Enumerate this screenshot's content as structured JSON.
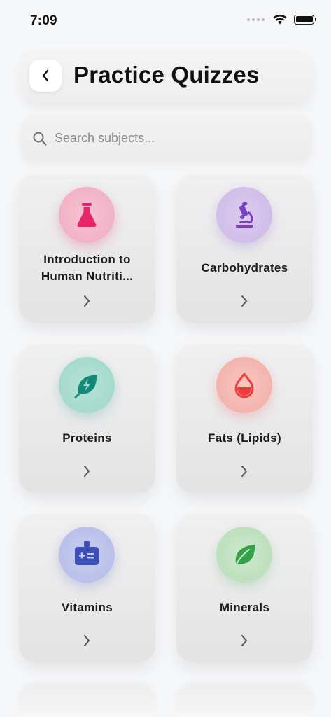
{
  "status_bar": {
    "time": "7:09"
  },
  "header": {
    "title": "Practice Quizzes",
    "back_icon": "chevron-left-icon"
  },
  "search": {
    "placeholder": "Search subjects...",
    "value": ""
  },
  "subjects": [
    {
      "label": "Introduction to Human Nutriti...",
      "icon": "flask-icon",
      "color": "#e8246a",
      "bg": "#f2b5c8"
    },
    {
      "label": "Carbohydrates",
      "icon": "microscope-icon",
      "color": "#7b3fc4",
      "bg": "#d2c0ea"
    },
    {
      "label": "Proteins",
      "icon": "leaf-bolt-icon",
      "color": "#138a78",
      "bg": "#a9dccf"
    },
    {
      "label": "Fats (Lipids)",
      "icon": "droplet-icon",
      "color": "#ef3b3b",
      "bg": "#f6b9b3"
    },
    {
      "label": "Vitamins",
      "icon": "medical-kit-icon",
      "color": "#3c4fb6",
      "bg": "#bcc3ea"
    },
    {
      "label": "Minerals",
      "icon": "leaf-icon",
      "color": "#35a048",
      "bg": "#bfe2c0"
    }
  ]
}
